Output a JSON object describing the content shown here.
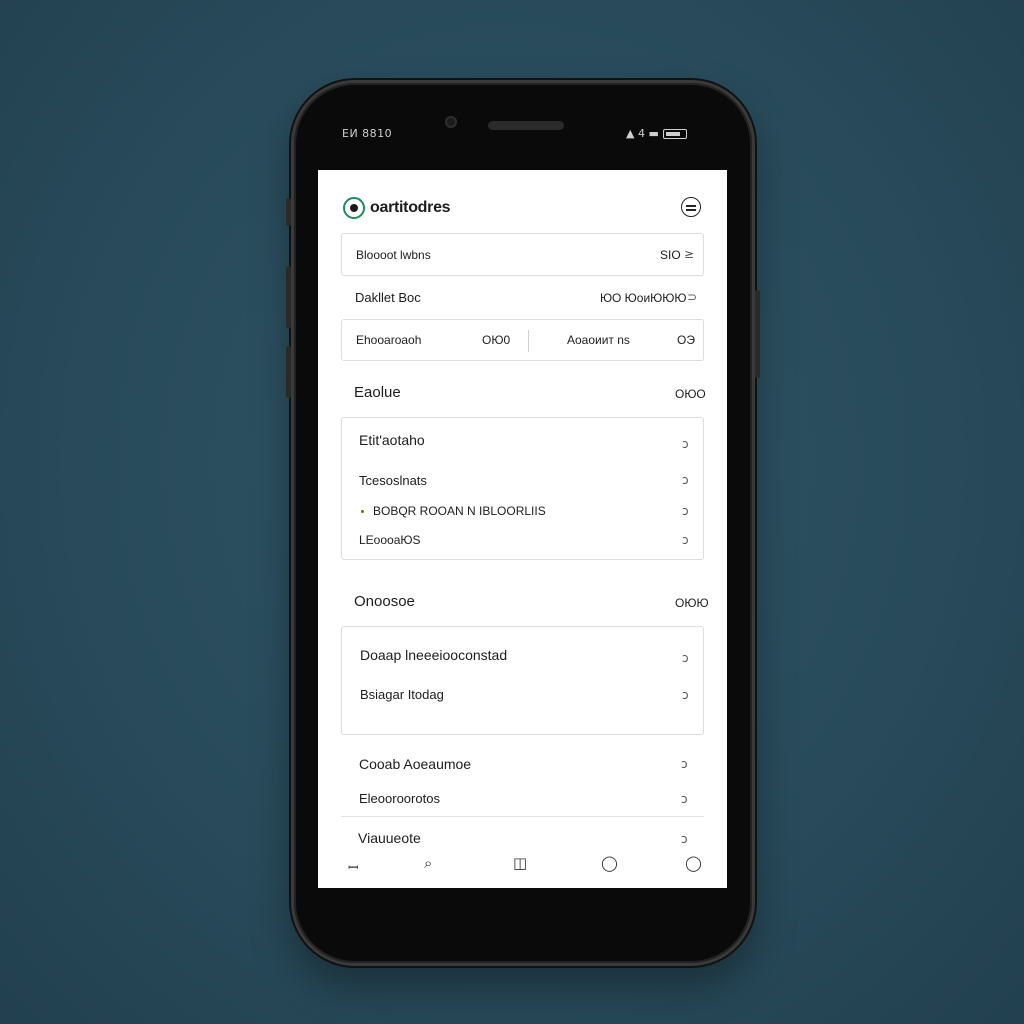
{
  "status_bar": {
    "left_text": "ЕИ 8810",
    "right_text": "▲ 4 ▬"
  },
  "header": {
    "app_title": "oartitodres"
  },
  "search_row": {
    "label": "Bloooot lwbns",
    "value": "SIO",
    "action_icon": "≥"
  },
  "info_row": {
    "label": "Dakllet Boc",
    "value": "ЮО ЮоиЮЮЮ",
    "action_icon": "⊃"
  },
  "split_row": {
    "left_label": "Ehooaroaoh",
    "left_value": "ОЮ0",
    "right_label": "Aоаоиит ns",
    "right_value": "ОЭ"
  },
  "section1": {
    "title": "Eaolue",
    "side": "ОЮО",
    "items": [
      {
        "label": "Etit'aotaho",
        "icon": "ↄ"
      },
      {
        "label": "Tcesoslnats",
        "icon": "ↄ"
      },
      {
        "label": "BOBQR ROOAN N IBLOORLIIS",
        "icon": "ↄ",
        "bullet": true
      },
      {
        "label": "LЕоооаЮS",
        "icon": "ↄ"
      }
    ]
  },
  "section2": {
    "title": "Onoosoe",
    "side": "OЮЮ",
    "items": [
      {
        "label": "Doaap lneeeiooconstad",
        "icon": "ↄ"
      },
      {
        "label": "Bsiagar Itodag",
        "icon": "ↄ"
      }
    ]
  },
  "section3": {
    "items": [
      {
        "label": "Cooab Aoeaumoe",
        "icon": "ↄ"
      },
      {
        "label": "Eleooroorotos",
        "icon": "ↄ"
      },
      {
        "label": "Viauueote",
        "icon": "ↄ"
      }
    ]
  },
  "bottom_nav": [
    {
      "name": "home-icon",
      "glyph": "ꟷ"
    },
    {
      "name": "search-icon",
      "glyph": "⌕"
    },
    {
      "name": "library-icon",
      "glyph": "◫"
    },
    {
      "name": "chat-icon",
      "glyph": "◯"
    },
    {
      "name": "profile-icon",
      "glyph": "◯"
    }
  ]
}
